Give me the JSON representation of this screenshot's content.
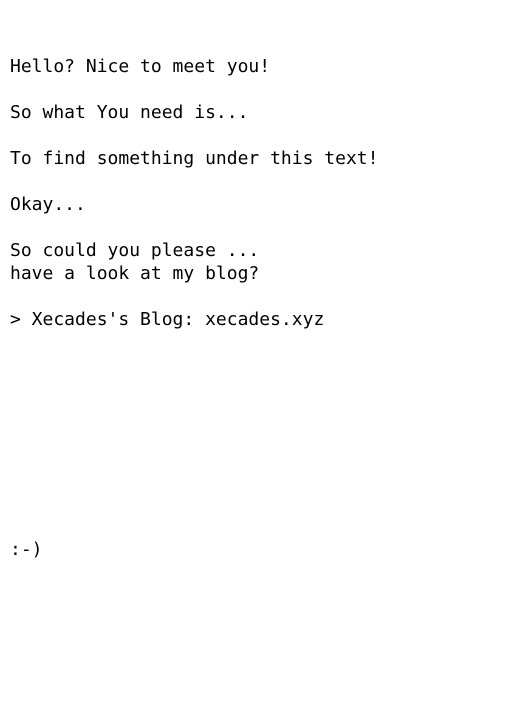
{
  "lines": {
    "greeting": "Hello? Nice to meet you!",
    "need": "So what You need is...",
    "find": "To find something under this text!",
    "okay": "Okay...",
    "please": "So could you please ...",
    "blog_question": "have a look at my blog?",
    "smiley": ":-)"
  },
  "blog_link": {
    "prefix": "> Xecades's Blog: ",
    "url_text": "xecades.xyz"
  }
}
